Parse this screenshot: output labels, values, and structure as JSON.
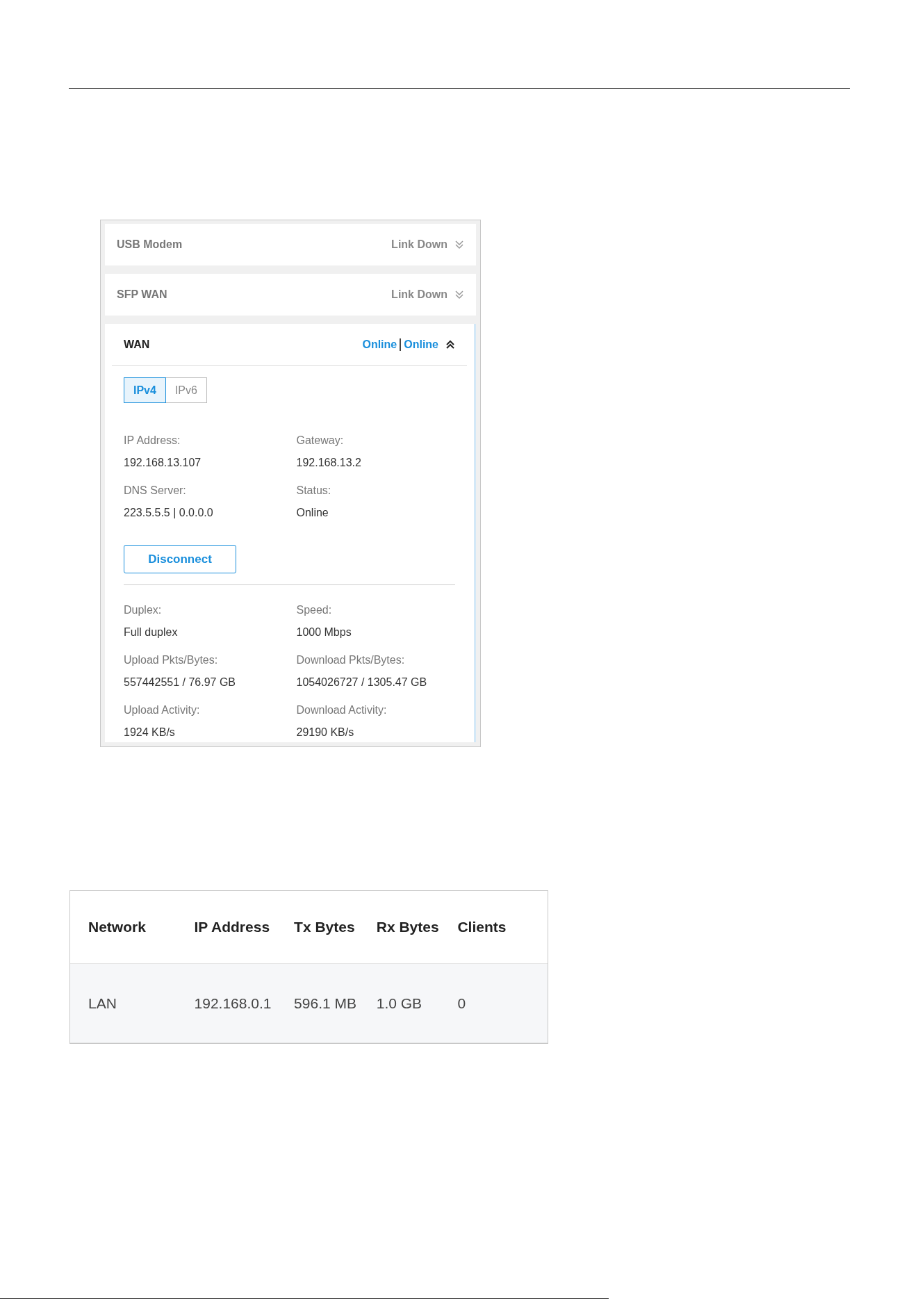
{
  "wan_panel": {
    "interfaces": [
      {
        "name": "USB Modem",
        "status": [
          "Link Down"
        ],
        "expanded": false
      },
      {
        "name": "SFP WAN",
        "status": [
          "Link Down"
        ],
        "expanded": false
      },
      {
        "name": "WAN",
        "status": [
          "Online",
          "Online"
        ],
        "expanded": true
      }
    ],
    "tabs": [
      {
        "label": "IPv4",
        "selected": true
      },
      {
        "label": "IPv6",
        "selected": false
      }
    ],
    "fields": [
      {
        "label": "IP Address:",
        "value": "192.168.13.107"
      },
      {
        "label": "Gateway:",
        "value": "192.168.13.2"
      },
      {
        "label": "DNS Server:",
        "value": "223.5.5.5 | 0.0.0.0"
      },
      {
        "label": "Status:",
        "value": "Online"
      }
    ],
    "button": "Disconnect",
    "port_fields": [
      {
        "label": "Duplex:",
        "value": "Full duplex"
      },
      {
        "label": "Speed:",
        "value": "1000 Mbps"
      },
      {
        "label": "Upload Pkts/Bytes:",
        "value": "557442551 / 76.97 GB"
      },
      {
        "label": "Download Pkts/Bytes:",
        "value": "1054026727 / 1305.47 GB"
      },
      {
        "label": "Upload Activity:",
        "value": "1924 KB/s"
      },
      {
        "label": "Download Activity:",
        "value": "29190 KB/s"
      }
    ]
  },
  "lan_table": {
    "columns": [
      "Network",
      "IP Address",
      "Tx Bytes",
      "Rx Bytes",
      "Clients"
    ],
    "rows": [
      [
        "LAN",
        "192.168.0.1",
        "596.1 MB",
        "1.0 GB",
        "0"
      ]
    ]
  }
}
